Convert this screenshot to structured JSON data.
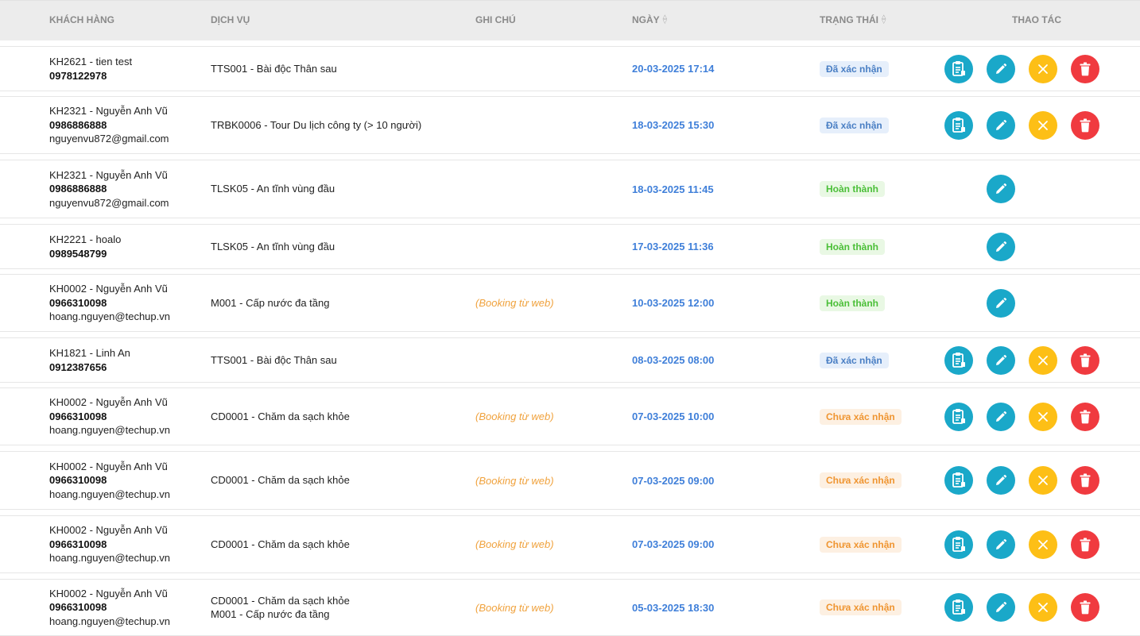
{
  "columns": {
    "customer": "KHÁCH HÀNG",
    "service": "DỊCH VỤ",
    "note": "GHI CHÚ",
    "date": "NGÀY",
    "status": "TRẠNG THÁI",
    "actions": "THAO TÁC"
  },
  "rows": [
    {
      "customer": "KH2621 - tien test",
      "phone": "0978122978",
      "email": "",
      "services": [
        "TTS001 - Bài độc Thân sau"
      ],
      "note": "",
      "date": "20-03-2025 17:14",
      "status": "Đã xác nhận",
      "status_kind": "confirmed",
      "actions": [
        "doc",
        "edit",
        "cancel",
        "delete"
      ]
    },
    {
      "customer": "KH2321 - Nguyễn Anh Vũ",
      "phone": "0986886888",
      "email": "nguyenvu872@gmail.com",
      "services": [
        "TRBK0006 - Tour Du lịch công ty (> 10 người)"
      ],
      "note": "",
      "date": "18-03-2025 15:30",
      "status": "Đã xác nhận",
      "status_kind": "confirmed",
      "actions": [
        "doc",
        "edit",
        "cancel",
        "delete"
      ]
    },
    {
      "customer": "KH2321 - Nguyễn Anh Vũ",
      "phone": "0986886888",
      "email": "nguyenvu872@gmail.com",
      "services": [
        "TLSK05 - An tĩnh vùng đầu"
      ],
      "note": "",
      "date": "18-03-2025 11:45",
      "status": "Hoàn thành",
      "status_kind": "done",
      "actions": [
        "edit"
      ]
    },
    {
      "customer": "KH2221 - hoalo",
      "phone": "0989548799",
      "email": "",
      "services": [
        "TLSK05 - An tĩnh vùng đầu"
      ],
      "note": "",
      "date": "17-03-2025 11:36",
      "status": "Hoàn thành",
      "status_kind": "done",
      "actions": [
        "edit"
      ]
    },
    {
      "customer": "KH0002 - Nguyễn Anh Vũ",
      "phone": "0966310098",
      "email": "hoang.nguyen@techup.vn",
      "services": [
        "M001 - Cấp nước đa tầng"
      ],
      "note": "(Booking từ web)",
      "date": "10-03-2025 12:00",
      "status": "Hoàn thành",
      "status_kind": "done",
      "actions": [
        "edit"
      ]
    },
    {
      "customer": "KH1821 - Linh An",
      "phone": "0912387656",
      "email": "",
      "services": [
        "TTS001 - Bài độc Thân sau"
      ],
      "note": "",
      "date": "08-03-2025 08:00",
      "status": "Đã xác nhận",
      "status_kind": "confirmed",
      "actions": [
        "doc",
        "edit",
        "cancel",
        "delete"
      ]
    },
    {
      "customer": "KH0002 - Nguyễn Anh Vũ",
      "phone": "0966310098",
      "email": "hoang.nguyen@techup.vn",
      "services": [
        "CD0001 - Chăm da sạch khỏe"
      ],
      "note": "(Booking từ web)",
      "date": "07-03-2025 10:00",
      "status": "Chưa xác nhận",
      "status_kind": "pending",
      "actions": [
        "doc",
        "edit",
        "cancel",
        "delete"
      ]
    },
    {
      "customer": "KH0002 - Nguyễn Anh Vũ",
      "phone": "0966310098",
      "email": "hoang.nguyen@techup.vn",
      "services": [
        "CD0001 - Chăm da sạch khỏe"
      ],
      "note": "(Booking từ web)",
      "date": "07-03-2025 09:00",
      "status": "Chưa xác nhận",
      "status_kind": "pending",
      "actions": [
        "doc",
        "edit",
        "cancel",
        "delete"
      ]
    },
    {
      "customer": "KH0002 - Nguyễn Anh Vũ",
      "phone": "0966310098",
      "email": "hoang.nguyen@techup.vn",
      "services": [
        "CD0001 - Chăm da sạch khỏe"
      ],
      "note": "(Booking từ web)",
      "date": "07-03-2025 09:00",
      "status": "Chưa xác nhận",
      "status_kind": "pending",
      "actions": [
        "doc",
        "edit",
        "cancel",
        "delete"
      ]
    },
    {
      "customer": "KH0002 - Nguyễn Anh Vũ",
      "phone": "0966310098",
      "email": "hoang.nguyen@techup.vn",
      "services": [
        "CD0001 - Chăm da sạch khỏe",
        "M001 - Cấp nước đa tầng"
      ],
      "note": "(Booking từ web)",
      "date": "05-03-2025 18:30",
      "status": "Chưa xác nhận",
      "status_kind": "pending",
      "actions": [
        "doc",
        "edit",
        "cancel",
        "delete"
      ]
    }
  ],
  "icons": {
    "sort": "sort-icon",
    "doc": "document-icon",
    "edit": "pencil-icon",
    "cancel": "close-icon",
    "delete": "trash-icon"
  },
  "colors": {
    "date": "#3f7fd9",
    "note": "#f0a23d",
    "btn_doc": "#1aa8c9",
    "btn_edit": "#1aa8c9",
    "btn_cancel": "#fdbf16",
    "btn_delete": "#f03a3f"
  }
}
